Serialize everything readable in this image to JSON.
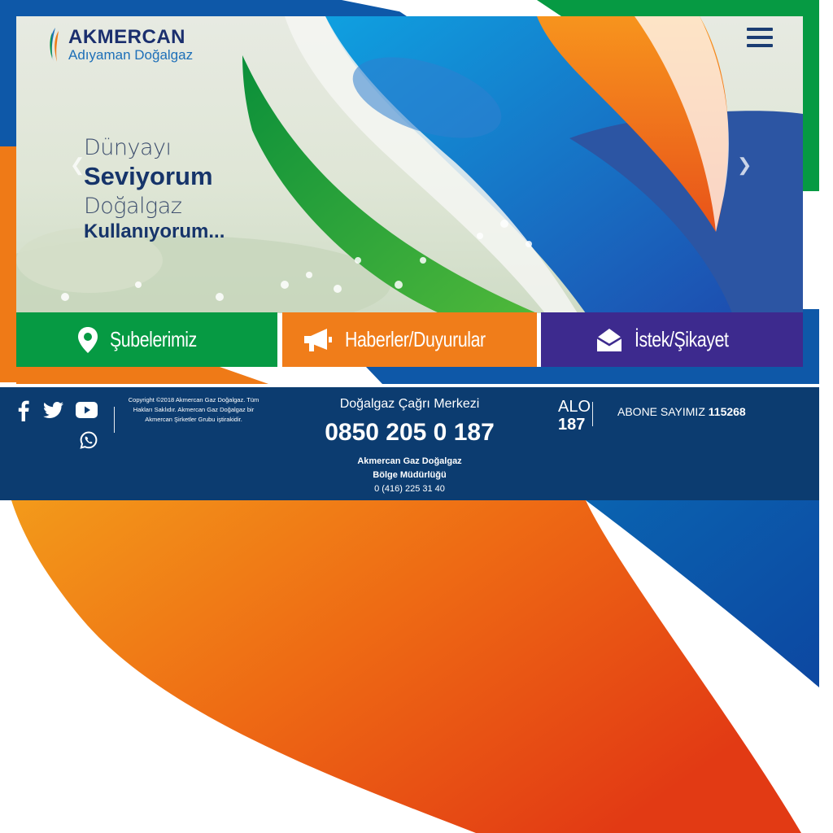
{
  "brand": {
    "name": "AKMERCAN",
    "subtitle": "Adıyaman Doğalgaz"
  },
  "hero": {
    "line1": "Dünyayı",
    "line2": "Seviyorum",
    "line3": "Doğalgaz",
    "line4": "Kullanıyorum..."
  },
  "tiles": [
    {
      "label": "Şubelerimiz",
      "icon": "map-pin-icon",
      "color": "#069a43"
    },
    {
      "label": "Haberler/Duyurular",
      "icon": "megaphone-icon",
      "color": "#f07d1a"
    },
    {
      "label": "İstek/Şikayet",
      "icon": "envelope-open-icon",
      "color": "#3d2a8e"
    }
  ],
  "footer": {
    "copyright": "Copyright ©2018 Akmercan Gaz Doğalgaz. Tüm Hakları Saklıdır. Akmercan Gaz Doğalgaz bir Akmercan Şirketler Grubu iştirakidir.",
    "call_center_title": "Doğalgaz Çağrı Merkezi",
    "call_center_phone": "0850 205 0 187",
    "office_name": "Akmercan Gaz Doğalgaz",
    "office_title": "Bölge Müdürlüğü",
    "office_phone": "0 (416) 225 31 40",
    "alo_label": "ALO",
    "alo_number": "187",
    "subscriber_label": "ABONE SAYIMIZ",
    "subscriber_count": "115268"
  },
  "social": [
    "facebook-icon",
    "twitter-icon",
    "youtube-icon",
    "whatsapp-icon"
  ],
  "colors": {
    "green": "#069a43",
    "orange": "#f07d1a",
    "purple": "#3d2a8e",
    "navy": "#0c3c70",
    "blue": "#1565c0"
  }
}
